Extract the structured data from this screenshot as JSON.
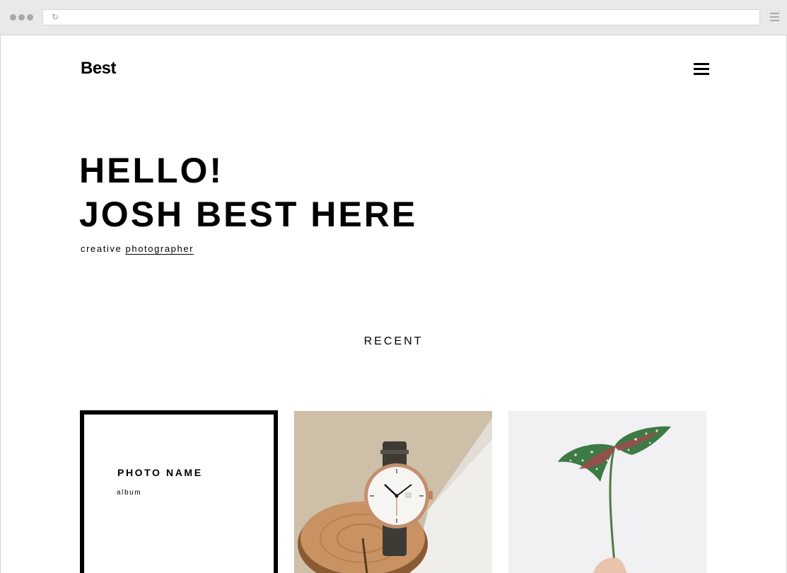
{
  "site": {
    "logo": "Best"
  },
  "hero": {
    "line1": "HELLO!",
    "line2": "JOSH BEST HERE",
    "tagline_prefix": "creative",
    "tagline_link": "photographer"
  },
  "recent": {
    "heading": "RECENT",
    "cards": [
      {
        "title": "PHOTO NAME",
        "subtitle": "album"
      }
    ]
  },
  "icons": {
    "browser_reload": "reload-icon",
    "browser_menu": "browser-menu-icon",
    "site_menu": "hamburger-menu-icon"
  },
  "colors": {
    "text": "#000000",
    "background": "#ffffff",
    "chrome": "#e9e9e9"
  }
}
